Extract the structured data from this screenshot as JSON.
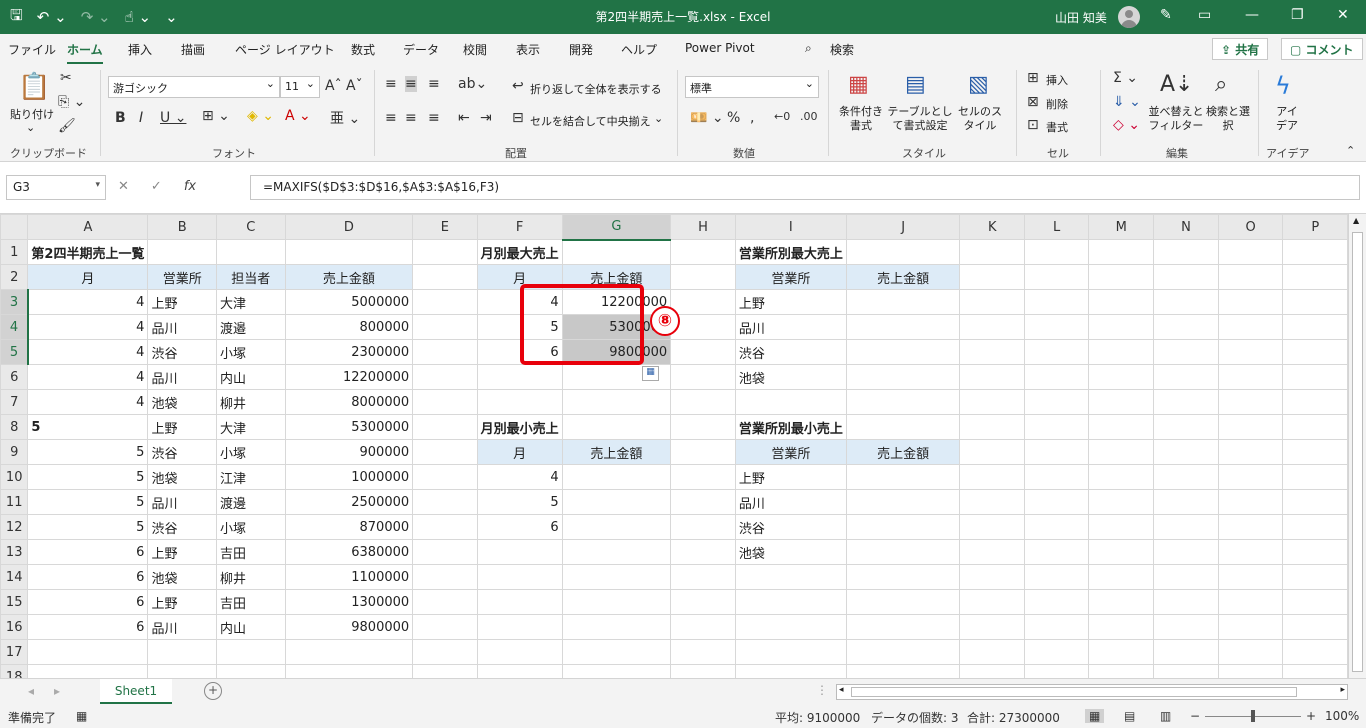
{
  "titlebar": {
    "filename": "第2四半期売上一覧.xlsx  -  Excel",
    "user": "山田 知美"
  },
  "menu": {
    "tabs": [
      "ファイル",
      "ホーム",
      "挿入",
      "描画",
      "ページ レイアウト",
      "数式",
      "データ",
      "校閲",
      "表示",
      "開発",
      "ヘルプ",
      "Power Pivot"
    ],
    "search": "検索",
    "share": "共有",
    "comment": "コメント"
  },
  "ribbon": {
    "clipboard": {
      "paste": "貼り付け",
      "label": "クリップボード"
    },
    "font": {
      "name": "游ゴシック",
      "size": "11",
      "label": "フォント"
    },
    "align": {
      "wrap": "折り返して全体を表示する",
      "merge": "セルを結合して中央揃え",
      "label": "配置"
    },
    "number": {
      "format": "標準",
      "label": "数値"
    },
    "styles": {
      "cond": "条件付き書式",
      "table": "テーブルとして書式設定",
      "cell": "セルのスタイル",
      "label": "スタイル"
    },
    "cells": {
      "insert": "挿入",
      "delete": "削除",
      "format": "書式",
      "label": "セル"
    },
    "edit": {
      "sort": "並べ替えとフィルター",
      "find": "検索と選択",
      "label": "編集"
    },
    "ideas": {
      "btn": "アイデア",
      "label": "アイデア"
    }
  },
  "formula": {
    "namebox": "G3",
    "text": "=MAXIFS($D$3:$D$16,$A$3:$A$16,F3)"
  },
  "columns": [
    "A",
    "B",
    "C",
    "D",
    "E",
    "F",
    "G",
    "H",
    "I",
    "J",
    "K",
    "L",
    "M",
    "N",
    "O",
    "P"
  ],
  "rows": [
    [
      "第2四半期売上一覧",
      "",
      "",
      "",
      "",
      "月別最大売上",
      "",
      "",
      "営業所別最大売上",
      "",
      "",
      "",
      "",
      "",
      "",
      ""
    ],
    [
      "月",
      "営業所",
      "担当者",
      "売上金額",
      "",
      "月",
      "売上金額",
      "",
      "営業所",
      "売上金額",
      "",
      "",
      "",
      "",
      "",
      ""
    ],
    [
      "4",
      "上野",
      "大津",
      "5000000",
      "",
      "4",
      "12200000",
      "",
      "上野",
      "",
      "",
      "",
      "",
      "",
      "",
      ""
    ],
    [
      "4",
      "品川",
      "渡邉",
      "800000",
      "",
      "5",
      "5300000",
      "",
      "品川",
      "",
      "",
      "",
      "",
      "",
      "",
      ""
    ],
    [
      "4",
      "渋谷",
      "小塚",
      "2300000",
      "",
      "6",
      "9800000",
      "",
      "渋谷",
      "",
      "",
      "",
      "",
      "",
      "",
      ""
    ],
    [
      "4",
      "品川",
      "内山",
      "12200000",
      "",
      "",
      "",
      "",
      "池袋",
      "",
      "",
      "",
      "",
      "",
      "",
      ""
    ],
    [
      "4",
      "池袋",
      "柳井",
      "8000000",
      "",
      "",
      "",
      "",
      "",
      "",
      "",
      "",
      "",
      "",
      "",
      ""
    ],
    [
      "5",
      "上野",
      "大津",
      "5300000",
      "",
      "月別最小売上",
      "",
      "",
      "営業所別最小売上",
      "",
      "",
      "",
      "",
      "",
      "",
      ""
    ],
    [
      "5",
      "渋谷",
      "小塚",
      "900000",
      "",
      "月",
      "売上金額",
      "",
      "営業所",
      "売上金額",
      "",
      "",
      "",
      "",
      "",
      ""
    ],
    [
      "5",
      "池袋",
      "江津",
      "1000000",
      "",
      "4",
      "",
      "",
      "上野",
      "",
      "",
      "",
      "",
      "",
      "",
      ""
    ],
    [
      "5",
      "品川",
      "渡邊",
      "2500000",
      "",
      "5",
      "",
      "",
      "品川",
      "",
      "",
      "",
      "",
      "",
      "",
      ""
    ],
    [
      "5",
      "渋谷",
      "小塚",
      "870000",
      "",
      "6",
      "",
      "",
      "渋谷",
      "",
      "",
      "",
      "",
      "",
      "",
      ""
    ],
    [
      "6",
      "上野",
      "吉田",
      "6380000",
      "",
      "",
      "",
      "",
      "池袋",
      "",
      "",
      "",
      "",
      "",
      "",
      ""
    ],
    [
      "6",
      "池袋",
      "柳井",
      "1100000",
      "",
      "",
      "",
      "",
      "",
      "",
      "",
      "",
      "",
      "",
      "",
      ""
    ],
    [
      "6",
      "上野",
      "吉田",
      "1300000",
      "",
      "",
      "",
      "",
      "",
      "",
      "",
      "",
      "",
      "",
      "",
      ""
    ],
    [
      "6",
      "品川",
      "内山",
      "9800000",
      "",
      "",
      "",
      "",
      "",
      "",
      "",
      "",
      "",
      "",
      "",
      ""
    ],
    [
      "",
      "",
      "",
      "",
      "",
      "",
      "",
      "",
      "",
      "",
      "",
      "",
      "",
      "",
      "",
      ""
    ],
    [
      "",
      "",
      "",
      "",
      "",
      "",
      "",
      "",
      "",
      "",
      "",
      "",
      "",
      "",
      "",
      ""
    ]
  ],
  "annotation": "⑧",
  "sheet": {
    "name": "Sheet1"
  },
  "status": {
    "ready": "準備完了",
    "avg": "平均: 9100000",
    "count": "データの個数: 3",
    "sum": "合計: 27300000",
    "zoom": "100%"
  }
}
